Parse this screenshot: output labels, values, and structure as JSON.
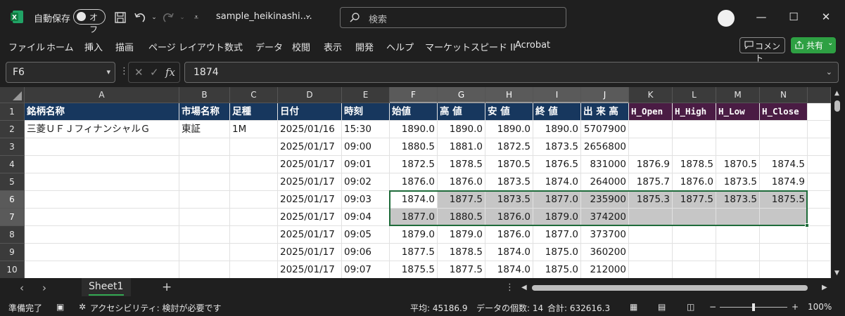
{
  "titlebar": {
    "autosave_label": "自動保存",
    "autosave_state": "オフ",
    "doc_title": "sample_heikinashi.…",
    "search_placeholder": "検索"
  },
  "ribbon": {
    "tabs": [
      "ファイル",
      "ホーム",
      "挿入",
      "描画",
      "ページ レイアウト",
      "数式",
      "データ",
      "校閲",
      "表示",
      "開発",
      "ヘルプ",
      "マーケットスピード II",
      "Acrobat"
    ],
    "comment_label": "コメント",
    "share_label": "共有"
  },
  "formula_bar": {
    "name_box": "F6",
    "formula": "1874",
    "fx": "fx"
  },
  "grid": {
    "columns": [
      "A",
      "B",
      "C",
      "D",
      "E",
      "F",
      "G",
      "H",
      "I",
      "J",
      "K",
      "L",
      "M",
      "N"
    ],
    "rows": [
      "1",
      "2",
      "3",
      "4",
      "5",
      "6",
      "7",
      "8",
      "9",
      "10"
    ],
    "header": [
      "銘柄名称",
      "市場名称",
      "足種",
      "日付",
      "時刻",
      "始値",
      "高 値",
      "安 値",
      "終 値",
      "出 来 高",
      "H_Open",
      "H_High",
      "H_Low",
      "H_Close"
    ],
    "data": [
      [
        "三菱ＵＦＪフィナンシャルＧ",
        "東証",
        "1M",
        "2025/01/16",
        "15:30",
        "1890.0",
        "1890.0",
        "1890.0",
        "1890.0",
        "5707900",
        "",
        "",
        "",
        ""
      ],
      [
        "",
        "",
        "",
        "2025/01/17",
        "09:00",
        "1880.5",
        "1881.0",
        "1872.5",
        "1873.5",
        "2656800",
        "",
        "",
        "",
        ""
      ],
      [
        "",
        "",
        "",
        "2025/01/17",
        "09:01",
        "1872.5",
        "1878.5",
        "1870.5",
        "1876.5",
        "831000",
        "1876.9",
        "1878.5",
        "1870.5",
        "1874.5"
      ],
      [
        "",
        "",
        "",
        "2025/01/17",
        "09:02",
        "1876.0",
        "1876.0",
        "1873.5",
        "1874.0",
        "264000",
        "1875.7",
        "1876.0",
        "1873.5",
        "1874.9"
      ],
      [
        "",
        "",
        "",
        "2025/01/17",
        "09:03",
        "1874.0",
        "1877.5",
        "1873.5",
        "1877.0",
        "235900",
        "1875.3",
        "1877.5",
        "1873.5",
        "1875.5"
      ],
      [
        "",
        "",
        "",
        "2025/01/17",
        "09:04",
        "1877.0",
        "1880.5",
        "1876.0",
        "1879.0",
        "374200",
        "",
        "",
        "",
        ""
      ],
      [
        "",
        "",
        "",
        "2025/01/17",
        "09:05",
        "1879.0",
        "1879.0",
        "1876.0",
        "1877.0",
        "373700",
        "",
        "",
        "",
        ""
      ],
      [
        "",
        "",
        "",
        "2025/01/17",
        "09:06",
        "1877.5",
        "1878.5",
        "1874.0",
        "1875.0",
        "360200",
        "",
        "",
        "",
        ""
      ],
      [
        "",
        "",
        "",
        "2025/01/17",
        "09:07",
        "1875.5",
        "1877.5",
        "1874.0",
        "1875.0",
        "212000",
        "",
        "",
        "",
        ""
      ]
    ]
  },
  "sheets": {
    "active": "Sheet1"
  },
  "status": {
    "ready": "準備完了",
    "accessibility": "アクセシビリティ: 検討が必要です",
    "average": "平均: 45186.9",
    "count": "データの個数: 14",
    "sum": "合計: 632616.3",
    "zoom": "100%"
  },
  "colors": {
    "header_blue": "#17375e",
    "header_purple": "#4a1c44",
    "selection": "#1e6b3a",
    "share_green": "#2ea043"
  }
}
